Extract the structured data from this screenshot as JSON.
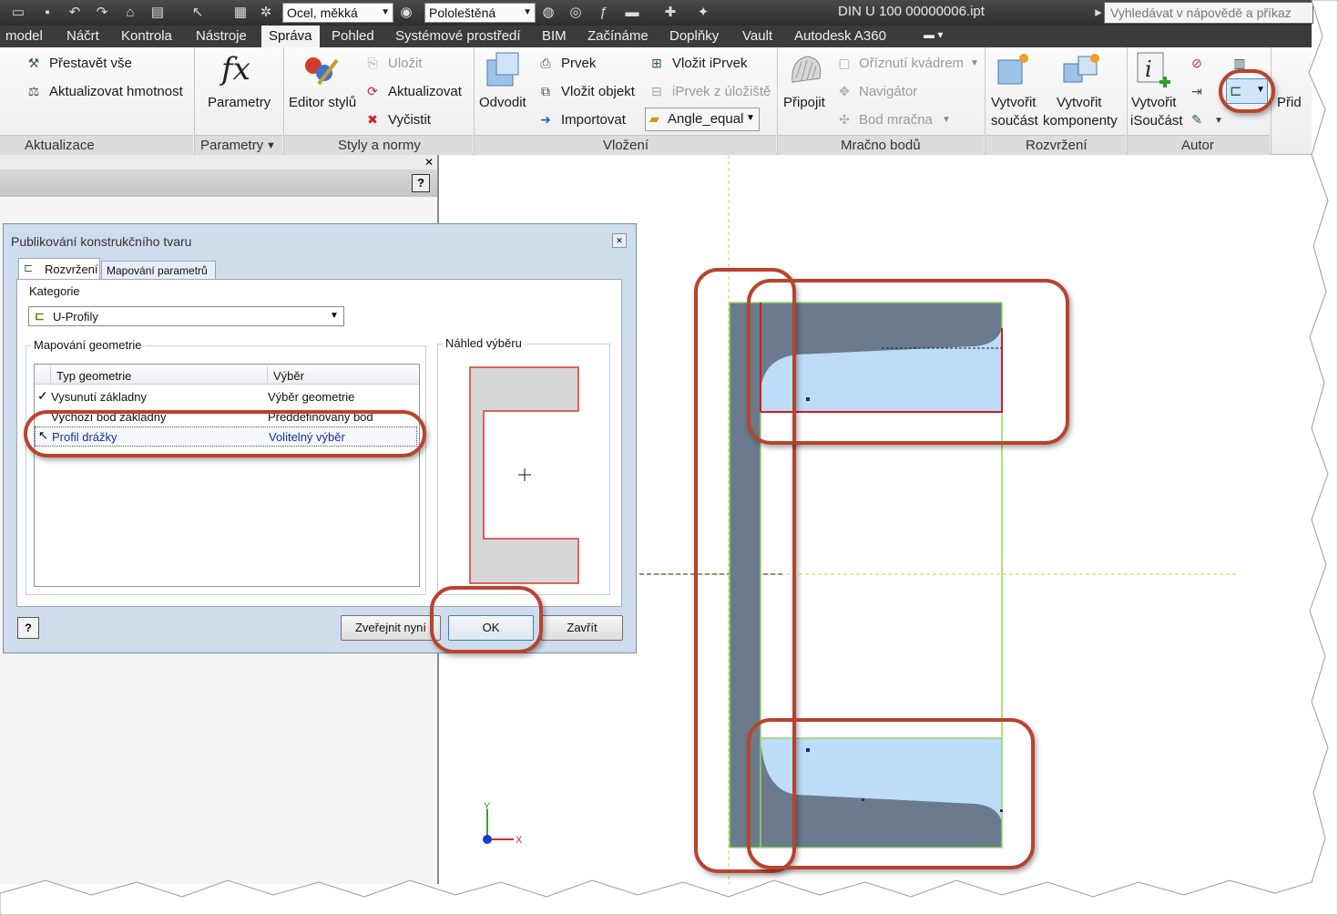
{
  "qat": {
    "material": "Ocel, měkká",
    "appearance": "Pololeštěná",
    "document_title": "DIN U 100 00000006.ipt",
    "help_placeholder": "Vyhledávat v nápovědě a příkaz"
  },
  "tabs": [
    "model",
    "Náčrt",
    "Kontrola",
    "Nástroje",
    "Správa",
    "Pohled",
    "Systémové prostředí",
    "BIM",
    "Začínáme",
    "Doplňky",
    "Vault",
    "Autodesk A360"
  ],
  "ribbon": {
    "update": {
      "rebuild_all": "Přestavět vše",
      "update_mass": "Aktualizovat hmotnost",
      "label": "Aktualizace"
    },
    "params": {
      "button": "Parametry",
      "label": "Parametry"
    },
    "styles": {
      "editor": "Editor stylů",
      "save": "Uložit",
      "update": "Aktualizovat",
      "purge": "Vyčistit",
      "label": "Styly a normy"
    },
    "insert": {
      "derive": "Odvodit",
      "feature": "Prvek",
      "insert_object": "Vložit objekt",
      "import": "Importovat",
      "insert_ifeature": "Vložit iPrvek",
      "ifeature_from_repo": "iPrvek z úložiště",
      "angle_combo": "Angle_equal",
      "label": "Vložení"
    },
    "pointcloud": {
      "attach": "Připojit",
      "crop_box": "Oříznutí kvádrem",
      "navigator": "Navigátor",
      "cloud_point": "Bod mračna",
      "label": "Mračno bodů"
    },
    "layout": {
      "make_part_1": "Vytvořit",
      "make_part_2": "součást",
      "make_comp_1": "Vytvořit",
      "make_comp_2": "komponenty",
      "label": "Rozvržení"
    },
    "author": {
      "create_ipart_1": "Vytvořit",
      "create_ipart_2": "iSoučást",
      "label": "Autor",
      "next_partial": "Přid"
    }
  },
  "dialog": {
    "title": "Publikování konstrukčního tvaru",
    "tab_layout": "Rozvržení",
    "tab_params": "Mapování parametrů",
    "category_label": "Kategorie",
    "category_value": "U-Profily",
    "geometry_group": "Mapování geometrie",
    "col_type": "Typ geometrie",
    "col_selection": "Výběr",
    "rows": [
      {
        "type": "Vysunutí základny",
        "selection": "Výběr geometrie"
      },
      {
        "type": "Výchozí bod základny",
        "selection": "Předdefinovaný bod"
      },
      {
        "type": "Profil drážky",
        "selection": "Volitelný výběr"
      }
    ],
    "preview_label": "Náhled výběru",
    "btn_publish": "Zveřejnit nyní",
    "btn_ok": "OK",
    "btn_close": "Zavřít"
  },
  "axes": {
    "y": "Y",
    "x": "X"
  },
  "colors": {
    "ribbon_dark": "#3b3b3b",
    "highlight_oval": "#b8432f",
    "profile_fill": "#6b7a8c",
    "selection_fill": "#bcdcf7",
    "selection_edge": "#cc1f1f",
    "profile_edge": "#8fd46a"
  }
}
